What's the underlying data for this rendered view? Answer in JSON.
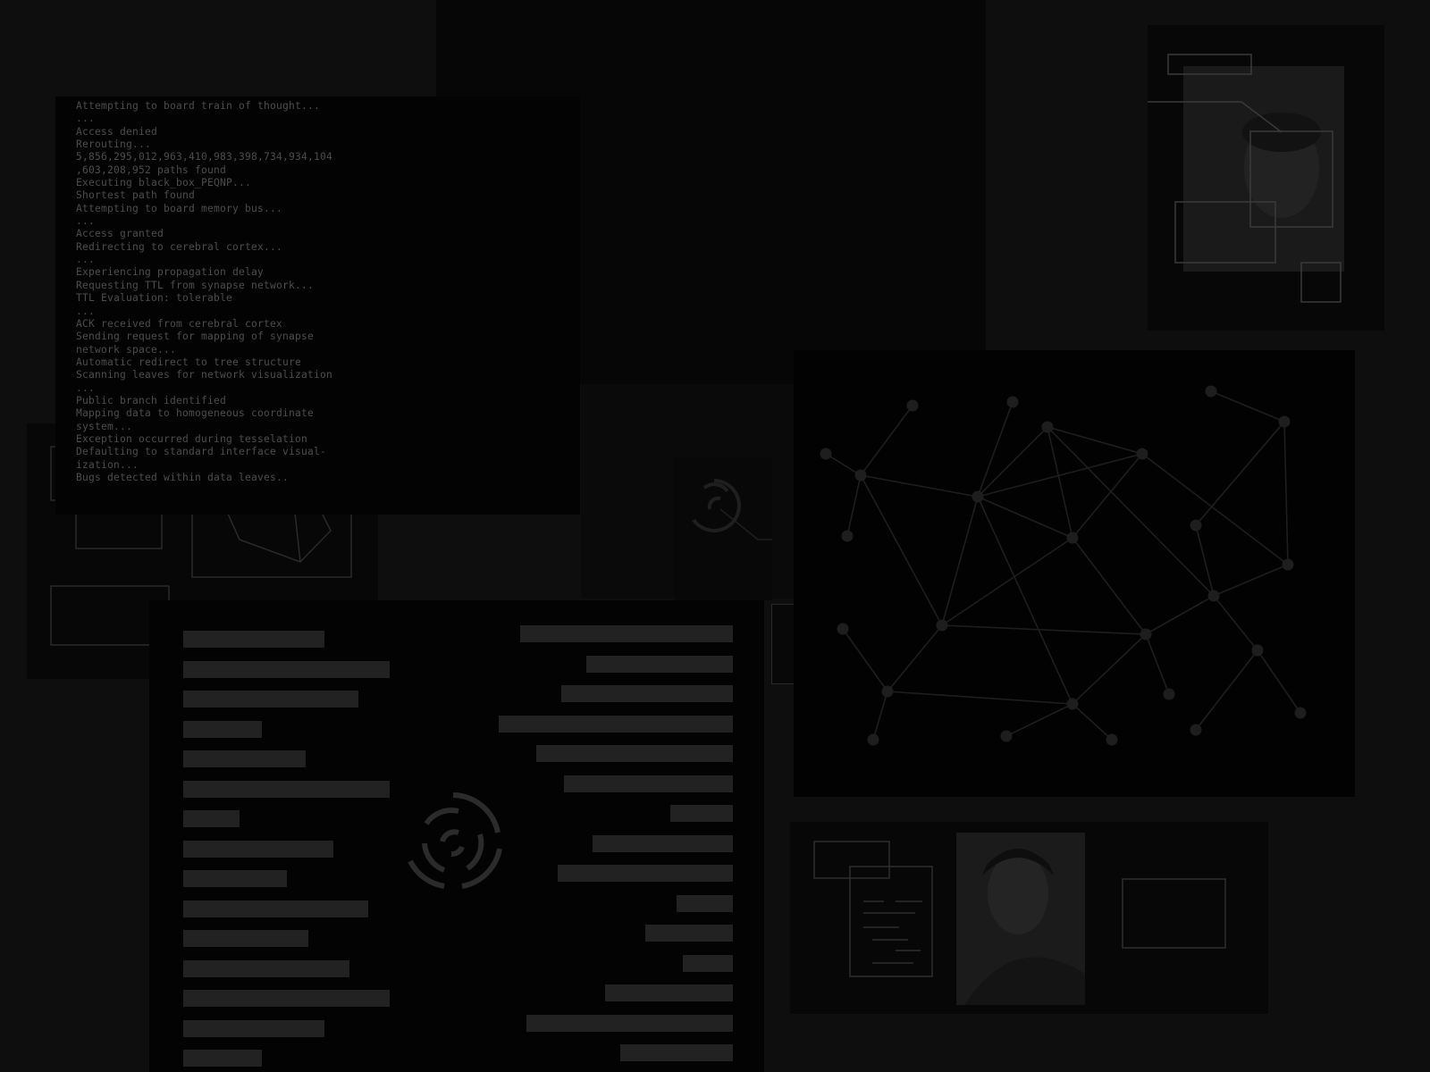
{
  "terminal": {
    "lines": [
      "Attempting to board train of thought...",
      "...",
      "Access denied",
      "Rerouting...",
      "5,856,295,012,963,410,983,398,734,934,104",
      ",603,208,952 paths found",
      "Executing black_box_PEQNP...",
      "Shortest path found",
      "Attempting to board memory bus...",
      "...",
      "Access granted",
      "Redirecting to cerebral cortex...",
      "...",
      "Experiencing propagation delay",
      "Requesting TTL from synapse network...",
      "TTL Evaluation: tolerable",
      "...",
      "ACK received from cerebral cortex",
      "Sending request for mapping of synapse",
      "network space...",
      "Automatic redirect to tree structure",
      "Scanning leaves for network visualization",
      "...",
      "Public branch identified",
      "Mapping data to homogeneous coordinate",
      "system...",
      "Exception occurred during tesselation",
      "Defaulting to standard interface visual-",
      "ization...",
      "Bugs detected within data leaves.."
    ]
  },
  "colors": {
    "background": "#0e0e0e",
    "panel": "#030303",
    "text": "#4c4c4c",
    "bar": "#222222",
    "stroke": "#2a2a2a",
    "node": "#1e1e1e"
  },
  "histogram": {
    "left_bars": [
      0.45,
      0.66,
      0.56,
      0.25,
      0.39,
      0.66,
      0.18,
      0.48,
      0.33,
      0.59,
      0.4,
      0.53,
      0.66,
      0.45,
      0.25
    ],
    "right_bars": [
      0.68,
      0.47,
      0.55,
      0.75,
      0.63,
      0.54,
      0.2,
      0.45,
      0.56,
      0.18,
      0.28,
      0.16,
      0.41,
      0.66,
      0.36
    ]
  },
  "icons": {
    "spiral": "concentric-spiral-icon"
  }
}
